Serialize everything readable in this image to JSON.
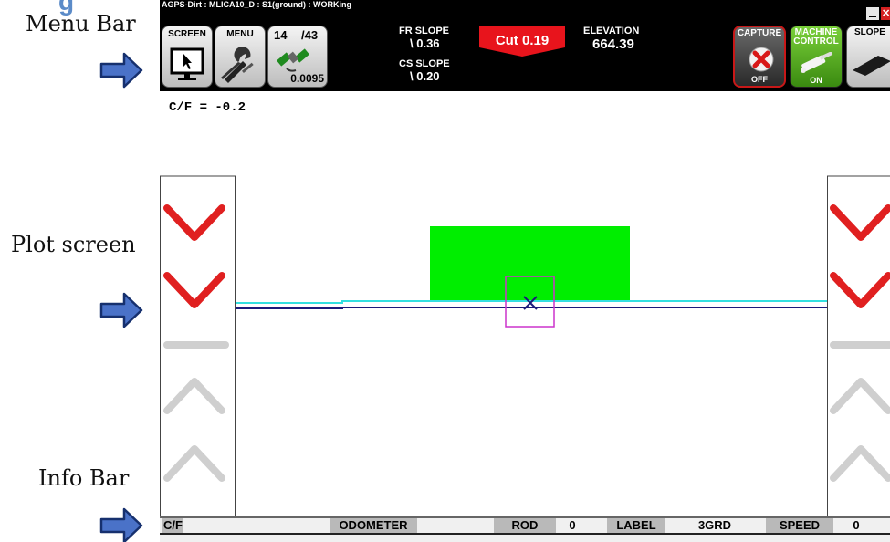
{
  "annotations": {
    "heading_fragment": "g",
    "menu_bar": "Menu Bar",
    "plot_screen": "Plot screen",
    "info_bar": "Info Bar"
  },
  "window": {
    "title": "AGPS-Dirt : MLICA10_D : S1(ground) : WORKing"
  },
  "toolbar": {
    "screen_label": "SCREEN",
    "menu_label": "MENU",
    "satellites_used": "14",
    "satellites_total": "/43",
    "gps_value": "0.0095"
  },
  "slopes": {
    "fr_label": "FR SLOPE",
    "fr_value": "\\ 0.36",
    "cs_label": "CS SLOPE",
    "cs_value": "\\ 0.20"
  },
  "cut": {
    "text": "Cut 0.19",
    "color": "#e8141c"
  },
  "elevation": {
    "label": "ELEVATION",
    "value": "664.39"
  },
  "right_buttons": {
    "capture_label_1": "CAPTURE",
    "capture_state": "OFF",
    "machine_label_1": "MACHINE",
    "machine_label_2": "CONTROL",
    "machine_state": "ON",
    "slope_label": "SLOPE"
  },
  "plot": {
    "cf_readout": "C/F = -0.2",
    "design_fill_color": "#00ee00",
    "design_line_color": "#33e0e0",
    "ground_line_color": "#1a1a7a",
    "marker_color": "#cc33cc",
    "arrow_down_color": "#e02020",
    "arrow_up_color": "#cfcfcf"
  },
  "infobar": {
    "cf_label": "C/F",
    "odometer_label": "ODOMETER",
    "rod_label": "ROD",
    "rod_value": "0",
    "label_label": "LABEL",
    "label_value": "3GRD",
    "speed_label": "SPEED",
    "speed_value": "0"
  }
}
